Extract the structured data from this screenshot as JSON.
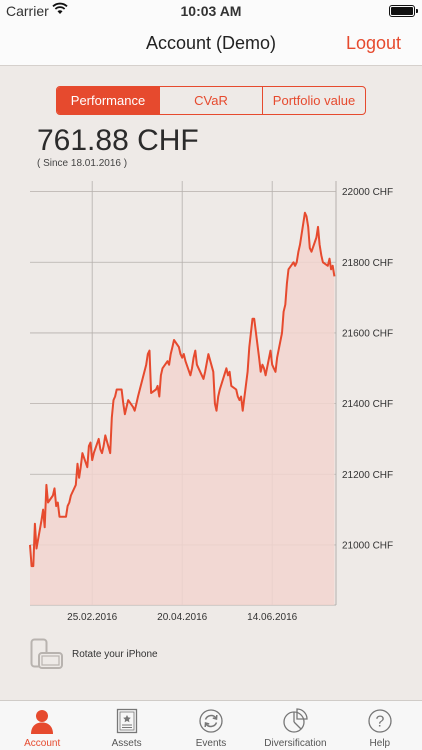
{
  "status_bar": {
    "carrier": "Carrier",
    "time": "10:03 AM"
  },
  "nav": {
    "title": "Account (Demo)",
    "logout": "Logout"
  },
  "segments": [
    {
      "label": "Performance",
      "active": true
    },
    {
      "label": "CVaR",
      "active": false
    },
    {
      "label": "Portfolio value",
      "active": false
    }
  ],
  "summary": {
    "value": "761.88 CHF",
    "since": "( Since 18.01.2016 )"
  },
  "colors": {
    "accent": "#e64a2e",
    "fill": "#f2d5cf",
    "grid": "#b5b0ac"
  },
  "chart_data": {
    "type": "area",
    "x_start": "2016-01-18",
    "y_tick_labels": [
      "22000 CHF",
      "21800 CHF",
      "21600 CHF",
      "21400 CHF",
      "21200 CHF",
      "21000 CHF"
    ],
    "y_ticks": [
      22000,
      21800,
      21600,
      21400,
      21200,
      21000
    ],
    "x_tick_labels": [
      "25.02.2016",
      "20.04.2016",
      "14.06.2016"
    ],
    "x_ticks": [
      "2016-02-25",
      "2016-04-20",
      "2016-06-14"
    ],
    "xlim": [
      "2016-01-18",
      "2016-07-23"
    ],
    "ylim": [
      20830,
      22030
    ],
    "grid": true,
    "x": [
      "2016-01-18",
      "2016-01-19",
      "2016-01-20",
      "2016-01-21",
      "2016-01-22",
      "2016-01-25",
      "2016-01-26",
      "2016-01-27",
      "2016-01-28",
      "2016-01-29",
      "2016-02-01",
      "2016-02-02",
      "2016-02-03",
      "2016-02-04",
      "2016-02-05",
      "2016-02-08",
      "2016-02-09",
      "2016-02-10",
      "2016-02-11",
      "2016-02-12",
      "2016-02-15",
      "2016-02-16",
      "2016-02-17",
      "2016-02-18",
      "2016-02-19",
      "2016-02-22",
      "2016-02-23",
      "2016-02-24",
      "2016-02-25",
      "2016-02-26",
      "2016-02-29",
      "2016-03-01",
      "2016-03-02",
      "2016-03-03",
      "2016-03-04",
      "2016-03-07",
      "2016-03-08",
      "2016-03-09",
      "2016-03-10",
      "2016-03-11",
      "2016-03-14",
      "2016-03-15",
      "2016-03-16",
      "2016-03-17",
      "2016-03-18",
      "2016-03-21",
      "2016-03-22",
      "2016-03-23",
      "2016-03-24",
      "2016-03-29",
      "2016-03-30",
      "2016-03-31",
      "2016-04-01",
      "2016-04-04",
      "2016-04-05",
      "2016-04-06",
      "2016-04-07",
      "2016-04-08",
      "2016-04-11",
      "2016-04-12",
      "2016-04-13",
      "2016-04-14",
      "2016-04-15",
      "2016-04-18",
      "2016-04-19",
      "2016-04-20",
      "2016-04-21",
      "2016-04-22",
      "2016-04-25",
      "2016-04-26",
      "2016-04-27",
      "2016-04-28",
      "2016-04-29",
      "2016-05-02",
      "2016-05-03",
      "2016-05-04",
      "2016-05-06",
      "2016-05-09",
      "2016-05-10",
      "2016-05-11",
      "2016-05-12",
      "2016-05-13",
      "2016-05-17",
      "2016-05-18",
      "2016-05-19",
      "2016-05-20",
      "2016-05-23",
      "2016-05-24",
      "2016-05-25",
      "2016-05-26",
      "2016-05-27",
      "2016-05-30",
      "2016-05-31",
      "2016-06-01",
      "2016-06-02",
      "2016-06-03",
      "2016-06-06",
      "2016-06-07",
      "2016-06-08",
      "2016-06-09",
      "2016-06-10",
      "2016-06-13",
      "2016-06-14",
      "2016-06-15",
      "2016-06-16",
      "2016-06-17",
      "2016-06-20",
      "2016-06-21",
      "2016-06-22",
      "2016-06-23",
      "2016-06-24",
      "2016-06-27",
      "2016-06-28",
      "2016-06-29",
      "2016-06-30",
      "2016-07-01",
      "2016-07-04",
      "2016-07-05",
      "2016-07-06",
      "2016-07-07",
      "2016-07-08",
      "2016-07-11",
      "2016-07-12",
      "2016-07-13",
      "2016-07-14",
      "2016-07-15",
      "2016-07-18",
      "2016-07-19",
      "2016-07-20",
      "2016-07-21",
      "2016-07-22"
    ],
    "series": [
      {
        "values": [
          21000,
          20940,
          20940,
          21060,
          20990,
          21070,
          21100,
          21050,
          21170,
          21120,
          21140,
          21160,
          21110,
          21120,
          21080,
          21080,
          21080,
          21110,
          21120,
          21140,
          21170,
          21230,
          21190,
          21220,
          21260,
          21220,
          21280,
          21290,
          21240,
          21260,
          21300,
          21270,
          21260,
          21280,
          21310,
          21260,
          21360,
          21410,
          21420,
          21440,
          21440,
          21400,
          21370,
          21390,
          21410,
          21390,
          21380,
          21400,
          21420,
          21510,
          21540,
          21550,
          21430,
          21440,
          21450,
          21420,
          21480,
          21500,
          21520,
          21510,
          21540,
          21560,
          21580,
          21560,
          21540,
          21530,
          21540,
          21520,
          21480,
          21500,
          21530,
          21550,
          21510,
          21480,
          21470,
          21490,
          21540,
          21490,
          21400,
          21380,
          21420,
          21440,
          21500,
          21480,
          21490,
          21450,
          21440,
          21420,
          21410,
          21420,
          21380,
          21490,
          21560,
          21600,
          21640,
          21640,
          21530,
          21490,
          21510,
          21500,
          21480,
          21550,
          21510,
          21500,
          21490,
          21530,
          21600,
          21660,
          21680,
          21740,
          21780,
          21800,
          21790,
          21800,
          21830,
          21850,
          21940,
          21930,
          21900,
          21840,
          21830,
          21870,
          21900,
          21850,
          21820,
          21800,
          21790,
          21810,
          21780,
          21790,
          21760
        ]
      }
    ]
  },
  "rotate_hint": "Rotate your iPhone",
  "tabs": [
    {
      "label": "Account",
      "icon": "person-icon",
      "active": true
    },
    {
      "label": "Assets",
      "icon": "certificate-icon",
      "active": false
    },
    {
      "label": "Events",
      "icon": "refresh-icon",
      "active": false
    },
    {
      "label": "Diversification",
      "icon": "pie-chart-icon",
      "active": false
    },
    {
      "label": "Help",
      "icon": "question-icon",
      "active": false
    }
  ]
}
